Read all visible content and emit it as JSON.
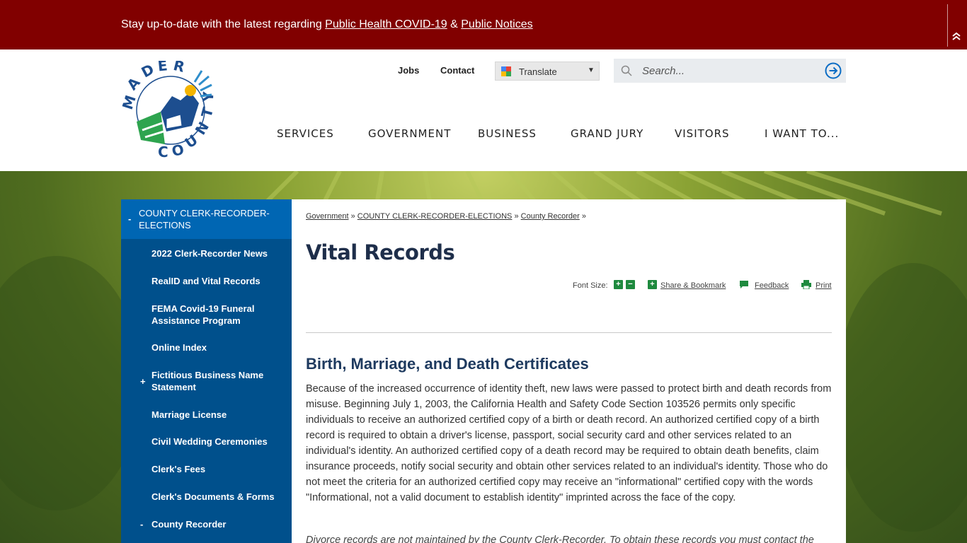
{
  "alert": {
    "prefix": "Stay up-to-date with  the latest regarding ",
    "link1": "Public Health COVID-19",
    "separator": " & ",
    "link2": "Public Notices",
    "toggle_icon": "double-chevron-up-icon"
  },
  "header": {
    "logo_alt": "Madera County",
    "utility_links": [
      "Jobs",
      "Contact"
    ],
    "translate_label": "Translate",
    "search_placeholder": "Search...",
    "nav": [
      "SERVICES",
      "GOVERNMENT",
      "BUSINESS",
      "GRAND JURY",
      "VISITORS",
      "I WANT TO..."
    ]
  },
  "sidebar": {
    "heading": "COUNTY CLERK-RECORDER-ELECTIONS",
    "heading_toggle": "-",
    "items": [
      {
        "label": "2022 Clerk-Recorder News",
        "toggle": ""
      },
      {
        "label": "RealID and Vital Records",
        "toggle": ""
      },
      {
        "label": "FEMA Covid-19 Funeral Assistance Program",
        "toggle": ""
      },
      {
        "label": "Online Index",
        "toggle": ""
      },
      {
        "label": "Fictitious Business Name Statement",
        "toggle": "+"
      },
      {
        "label": "Marriage License",
        "toggle": ""
      },
      {
        "label": "Civil Wedding Ceremonies",
        "toggle": ""
      },
      {
        "label": "Clerk's Fees",
        "toggle": ""
      },
      {
        "label": "Clerk's Documents & Forms",
        "toggle": ""
      },
      {
        "label": "County Recorder",
        "toggle": "-"
      }
    ]
  },
  "content": {
    "breadcrumb": [
      "Government",
      "COUNTY CLERK-RECORDER-ELECTIONS",
      "County Recorder"
    ],
    "breadcrumb_sep": "»",
    "title": "Vital Records",
    "font_size_label": "Font Size:",
    "share_label": "Share & Bookmark",
    "feedback_label": "Feedback",
    "print_label": "Print",
    "section_title": "Birth, Marriage, and Death Certificates",
    "paragraph": "Because of the increased occurrence of identity theft, new laws were passed to protect birth and death records from misuse. Beginning July 1, 2003, the California Health and Safety Code Section 103526 permits only specific individuals to receive an authorized certified copy of a birth or death record. An authorized certified copy of a birth record is required to obtain a driver's license, passport, social security card and other services related to an individual's identity. An authorized certified copy of a death record may be required to obtain death benefits, claim insurance proceeds, notify social security and obtain other services related to an individual's identity. Those who do not meet the criteria for an authorized certified copy may receive an \"informational\" certified copy with the words \"Informational, not a valid document to establish identity\" imprinted across the face of the copy.",
    "paragraph2": "Divorce records are not maintained by the County Clerk-Recorder.  To obtain these records you must contact the"
  },
  "colors": {
    "alert_bg": "#810000",
    "sidebar_bg": "#00508c",
    "sidebar_head_bg": "#0066b3",
    "accent_green": "#1e8a3e",
    "title_navy": "#1e2e4a"
  }
}
